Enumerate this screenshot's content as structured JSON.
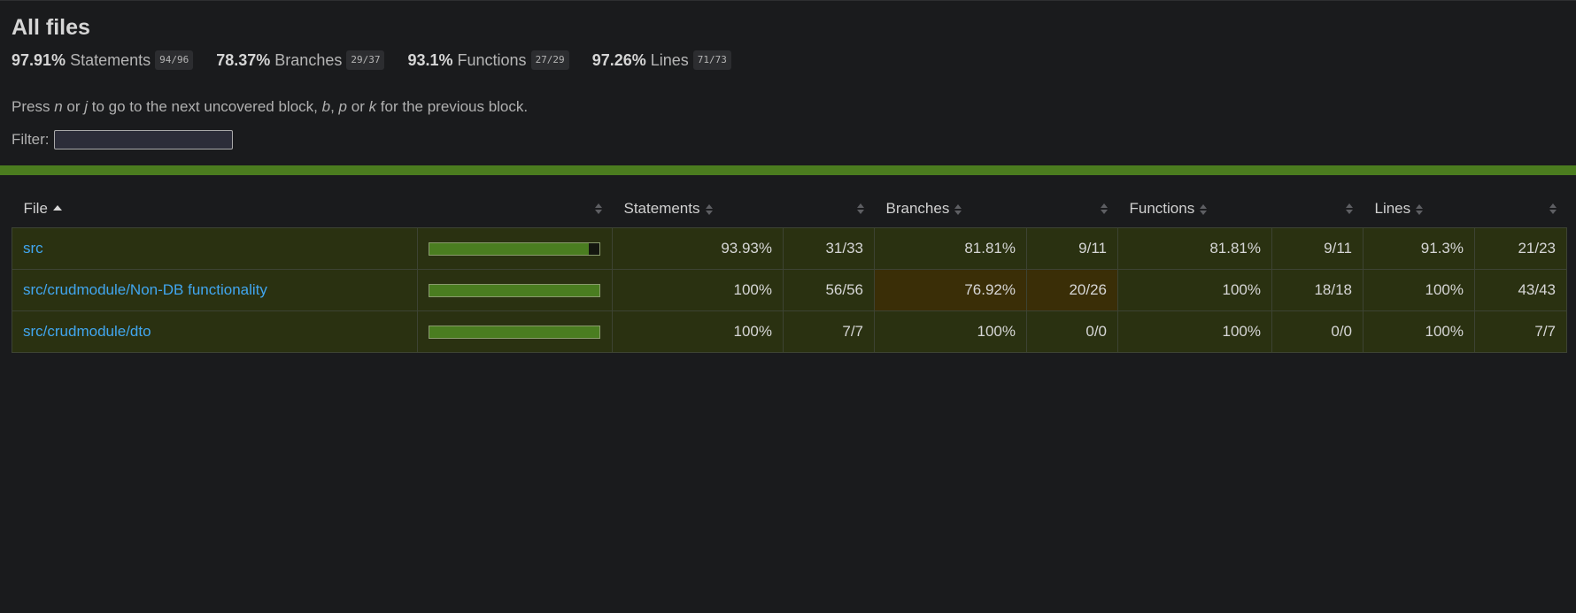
{
  "title": "All files",
  "summary": [
    {
      "pct": "97.91%",
      "label": "Statements",
      "frac": "94/96"
    },
    {
      "pct": "78.37%",
      "label": "Branches",
      "frac": "29/37"
    },
    {
      "pct": "93.1%",
      "label": "Functions",
      "frac": "27/29"
    },
    {
      "pct": "97.26%",
      "label": "Lines",
      "frac": "71/73"
    }
  ],
  "hint": {
    "part1": "Press ",
    "key_n": "n",
    "part2": " or ",
    "key_j": "j",
    "part3": " to go to the next uncovered block, ",
    "key_b": "b",
    "part4": ", ",
    "key_p": "p",
    "part5": " or ",
    "key_k": "k",
    "part6": " for the previous block."
  },
  "filter": {
    "label": "Filter:",
    "value": ""
  },
  "colors": {
    "status_high": "#4b7c1f",
    "row_high": "#2a3111",
    "cell_medium": "#3a2e07",
    "link": "#41a6ef"
  },
  "table": {
    "headers": {
      "file": "File",
      "statements": "Statements",
      "branches": "Branches",
      "functions": "Functions",
      "lines": "Lines"
    },
    "rows": [
      {
        "file": "src",
        "coverage_fraction": 0.9393,
        "statements_pct": "93.93%",
        "statements_frac": "31/33",
        "branches_pct": "81.81%",
        "branches_frac": "9/11",
        "functions_pct": "81.81%",
        "functions_frac": "9/11",
        "lines_pct": "91.3%",
        "lines_frac": "21/23"
      },
      {
        "file": "src/crudmodule/Non-DB functionality",
        "coverage_fraction": 1.0,
        "statements_pct": "100%",
        "statements_frac": "56/56",
        "branches_pct": "76.92%",
        "branches_frac": "20/26",
        "functions_pct": "100%",
        "functions_frac": "18/18",
        "lines_pct": "100%",
        "lines_frac": "43/43"
      },
      {
        "file": "src/crudmodule/dto",
        "coverage_fraction": 1.0,
        "statements_pct": "100%",
        "statements_frac": "7/7",
        "branches_pct": "100%",
        "branches_frac": "0/0",
        "functions_pct": "100%",
        "functions_frac": "0/0",
        "lines_pct": "100%",
        "lines_frac": "7/7"
      }
    ]
  }
}
